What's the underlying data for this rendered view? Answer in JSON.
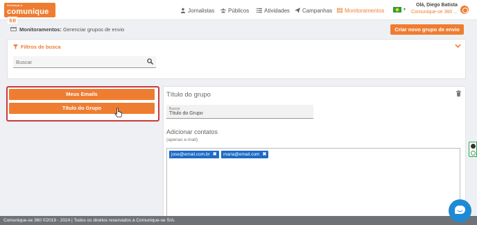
{
  "brand": {
    "sub": "Conheça o",
    "main": "comunique",
    "badge": "se",
    "color": "#ef7d31"
  },
  "nav": {
    "items": [
      {
        "label": "Jornalistas",
        "icon": "person-icon"
      },
      {
        "label": "Públicos",
        "icon": "users-icon"
      },
      {
        "label": "Atividades",
        "icon": "list-icon"
      },
      {
        "label": "Campanhas",
        "icon": "paper-plane-icon"
      },
      {
        "label": "Monitoramentos",
        "icon": "newspaper-icon",
        "active": true
      }
    ]
  },
  "user": {
    "greeting": "Olá, Diego Batista",
    "org": "Comunique-se 360 ..."
  },
  "breadcrumb": {
    "section": "Monitoramentos:",
    "page": "Gerenciar grupos de envio"
  },
  "create_button": "Criar novo grupo de envio",
  "filters": {
    "title": "Filtros de busca",
    "search_placeholder": "Buscar"
  },
  "groups": [
    {
      "label": "Meus Emails"
    },
    {
      "label": "Título do Grupo"
    }
  ],
  "editor": {
    "title": "Título do grupo",
    "name_field_label": "Buscar",
    "name_field_value": "Título do Grupo",
    "add_contacts_title": "Adicionar contatos",
    "add_contacts_hint": "(apenas e-mail)",
    "contacts": [
      {
        "email": "jose@email.com.br"
      },
      {
        "email": "maria@email.com"
      }
    ],
    "chip_remove": "✖"
  },
  "footer": "Comunique-se 360 ©2019 - 2024 | Todos os direitos reservados à Comunique-se S/A."
}
